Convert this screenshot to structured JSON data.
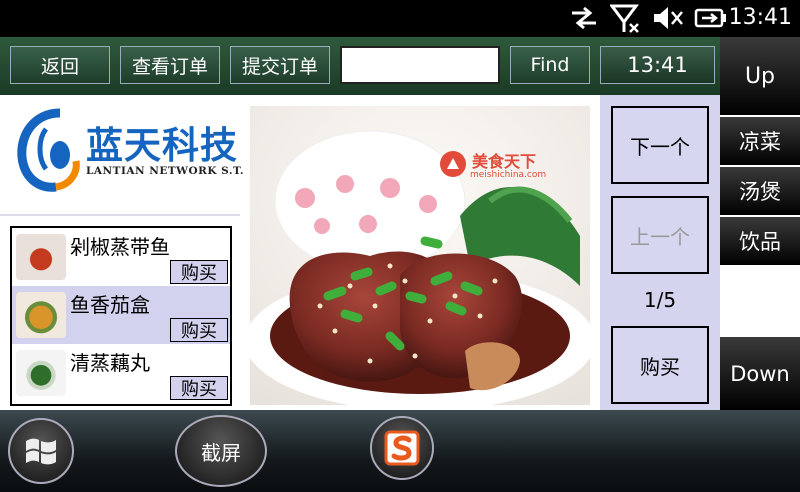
{
  "status_bar": {
    "time": "13:41"
  },
  "toolbar": {
    "back_label": "返回",
    "view_order_label": "查看订单",
    "submit_order_label": "提交订单",
    "search_value": "",
    "find_label": "Find",
    "clock": "13:41"
  },
  "right_menu": {
    "up_label": "Up",
    "categories": [
      "凉菜",
      "汤煲",
      "饮品"
    ],
    "down_label": "Down"
  },
  "logo": {
    "brand_cn": "蓝天科技",
    "brand_en": "LANTIAN NETWORK S.T."
  },
  "dishes": [
    {
      "name": "剁椒蒸带鱼",
      "buy_label": "购买",
      "selected": false
    },
    {
      "name": "鱼香茄盒",
      "buy_label": "购买",
      "selected": true
    },
    {
      "name": "清蒸藕丸",
      "buy_label": "购买",
      "selected": false
    }
  ],
  "photo": {
    "watermark_cn": "美食天下",
    "watermark_url": "meishichina.com"
  },
  "nav": {
    "next_label": "下一个",
    "prev_label": "上一个",
    "page_indicator": "1/5",
    "buy_label": "购买"
  },
  "taskbar": {
    "screenshot_label": "截屏"
  },
  "colors": {
    "toolbar_green": "#2f5a3c",
    "panel_lavender": "#d4d4ee",
    "selected_row": "#d2d2ee",
    "brand_blue": "#1565c0"
  }
}
